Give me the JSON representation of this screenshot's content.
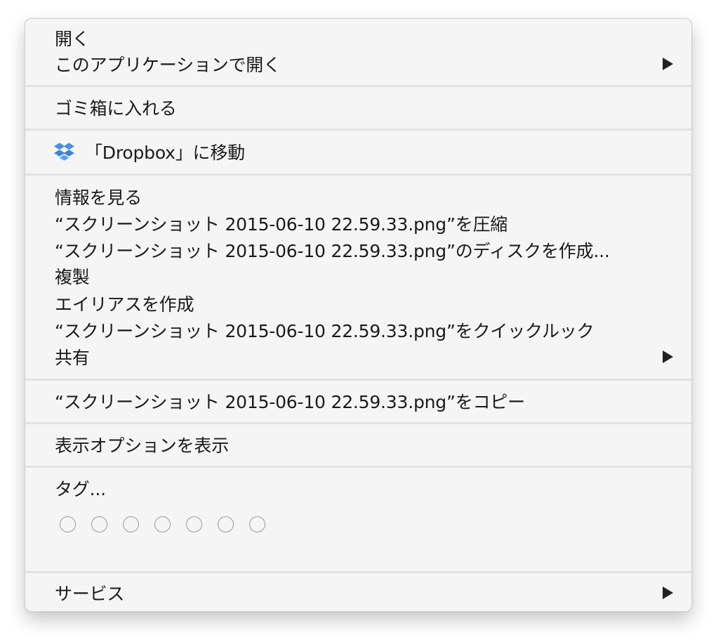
{
  "menu": {
    "section1": {
      "open": "開く",
      "open_with": "このアプリケーションで開く"
    },
    "section2": {
      "trash": "ゴミ箱に入れる"
    },
    "section3": {
      "dropbox_move": "「Dropbox」に移動",
      "icon": "dropbox-icon"
    },
    "section4": {
      "get_info": "情報を見る",
      "compress": "“スクリーンショット 2015-06-10 22.59.33.png”を圧縮",
      "burn_disc": "“スクリーンショット 2015-06-10 22.59.33.png”のディスクを作成...",
      "duplicate": "複製",
      "make_alias": "エイリアスを作成",
      "quick_look": "“スクリーンショット 2015-06-10 22.59.33.png”をクイックルック",
      "share": "共有"
    },
    "section5": {
      "copy": "“スクリーンショット 2015-06-10 22.59.33.png”をコピー"
    },
    "section6": {
      "view_options": "表示オプションを表示"
    },
    "section7": {
      "tags": "タグ...",
      "tag_colors": [
        "none",
        "none",
        "none",
        "none",
        "none",
        "none",
        "none"
      ]
    },
    "section8": {
      "services": "サービス"
    }
  },
  "colors": {
    "menu_background": "#f5f5f5",
    "text": "#1a1a1a",
    "separator": "#e2e2e2",
    "tag_circle_border": "#9a9a9a",
    "dropbox_blue": "#4a90d9"
  }
}
